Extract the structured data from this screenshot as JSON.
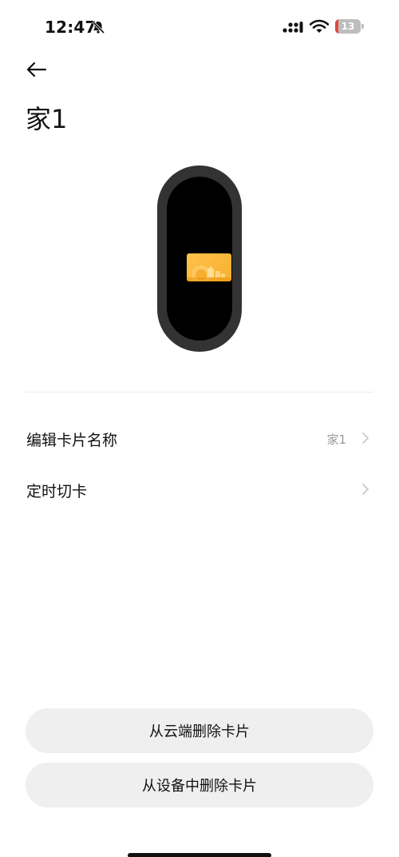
{
  "status_bar": {
    "time": "12:47",
    "battery_level": "13",
    "battery_fraction": 0.13,
    "icons": [
      "bell-off-icon",
      "signal-icon",
      "wifi-icon",
      "battery-icon"
    ]
  },
  "header": {
    "back_icon": "arrow-left-icon",
    "title": "家1"
  },
  "device_preview": {
    "device": "band",
    "card_color": "#f7b02e",
    "band_color": "#333333"
  },
  "settings": [
    {
      "label": "编辑卡片名称",
      "value": "家1"
    },
    {
      "label": "定时切卡",
      "value": ""
    }
  ],
  "actions": {
    "delete_cloud": "从云端删除卡片",
    "delete_device": "从设备中删除卡片"
  }
}
